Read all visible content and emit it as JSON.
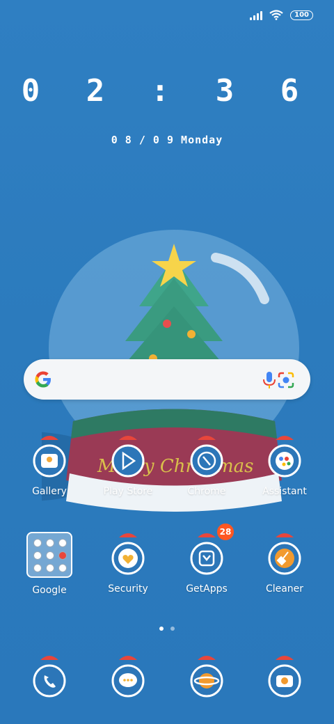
{
  "status_bar": {
    "battery": "100"
  },
  "clock": {
    "time": "0 2 : 3 6",
    "date": "0 8 / 0 9  Monday"
  },
  "wallpaper": {
    "caption": "Merry Christmas"
  },
  "search": {
    "colors": {
      "blue": "#4285F4",
      "red": "#EA4335",
      "yellow": "#FBBC05",
      "green": "#34A853"
    }
  },
  "apps_row1": [
    {
      "label": "Gallery",
      "icon": "gallery-icon"
    },
    {
      "label": "Play Store",
      "icon": "play-store-icon"
    },
    {
      "label": "Chrome",
      "icon": "chrome-icon"
    },
    {
      "label": "Assistant",
      "icon": "assistant-icon"
    }
  ],
  "apps_row2": [
    {
      "label": "Google",
      "icon": "folder-icon"
    },
    {
      "label": "Security",
      "icon": "security-icon"
    },
    {
      "label": "GetApps",
      "icon": "getapps-icon",
      "badge": "28"
    },
    {
      "label": "Cleaner",
      "icon": "cleaner-icon"
    }
  ],
  "dock": [
    {
      "icon": "phone-icon"
    },
    {
      "icon": "messages-icon"
    },
    {
      "icon": "browser-icon"
    },
    {
      "icon": "camera-icon"
    }
  ]
}
